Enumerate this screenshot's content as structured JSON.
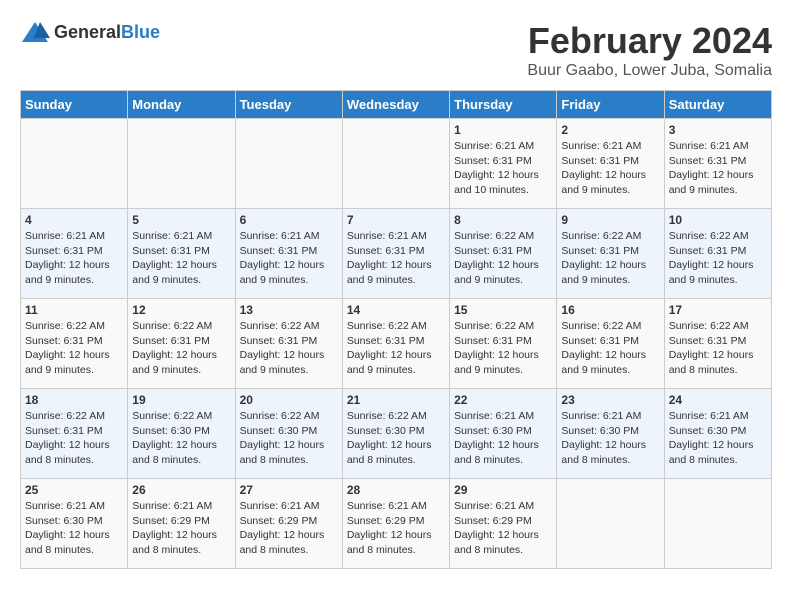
{
  "logo": {
    "general": "General",
    "blue": "Blue"
  },
  "title": "February 2024",
  "subtitle": "Buur Gaabo, Lower Juba, Somalia",
  "headers": [
    "Sunday",
    "Monday",
    "Tuesday",
    "Wednesday",
    "Thursday",
    "Friday",
    "Saturday"
  ],
  "weeks": [
    [
      {
        "day": "",
        "info": ""
      },
      {
        "day": "",
        "info": ""
      },
      {
        "day": "",
        "info": ""
      },
      {
        "day": "",
        "info": ""
      },
      {
        "day": "1",
        "info": "Sunrise: 6:21 AM\nSunset: 6:31 PM\nDaylight: 12 hours\nand 10 minutes."
      },
      {
        "day": "2",
        "info": "Sunrise: 6:21 AM\nSunset: 6:31 PM\nDaylight: 12 hours\nand 9 minutes."
      },
      {
        "day": "3",
        "info": "Sunrise: 6:21 AM\nSunset: 6:31 PM\nDaylight: 12 hours\nand 9 minutes."
      }
    ],
    [
      {
        "day": "4",
        "info": "Sunrise: 6:21 AM\nSunset: 6:31 PM\nDaylight: 12 hours\nand 9 minutes."
      },
      {
        "day": "5",
        "info": "Sunrise: 6:21 AM\nSunset: 6:31 PM\nDaylight: 12 hours\nand 9 minutes."
      },
      {
        "day": "6",
        "info": "Sunrise: 6:21 AM\nSunset: 6:31 PM\nDaylight: 12 hours\nand 9 minutes."
      },
      {
        "day": "7",
        "info": "Sunrise: 6:21 AM\nSunset: 6:31 PM\nDaylight: 12 hours\nand 9 minutes."
      },
      {
        "day": "8",
        "info": "Sunrise: 6:22 AM\nSunset: 6:31 PM\nDaylight: 12 hours\nand 9 minutes."
      },
      {
        "day": "9",
        "info": "Sunrise: 6:22 AM\nSunset: 6:31 PM\nDaylight: 12 hours\nand 9 minutes."
      },
      {
        "day": "10",
        "info": "Sunrise: 6:22 AM\nSunset: 6:31 PM\nDaylight: 12 hours\nand 9 minutes."
      }
    ],
    [
      {
        "day": "11",
        "info": "Sunrise: 6:22 AM\nSunset: 6:31 PM\nDaylight: 12 hours\nand 9 minutes."
      },
      {
        "day": "12",
        "info": "Sunrise: 6:22 AM\nSunset: 6:31 PM\nDaylight: 12 hours\nand 9 minutes."
      },
      {
        "day": "13",
        "info": "Sunrise: 6:22 AM\nSunset: 6:31 PM\nDaylight: 12 hours\nand 9 minutes."
      },
      {
        "day": "14",
        "info": "Sunrise: 6:22 AM\nSunset: 6:31 PM\nDaylight: 12 hours\nand 9 minutes."
      },
      {
        "day": "15",
        "info": "Sunrise: 6:22 AM\nSunset: 6:31 PM\nDaylight: 12 hours\nand 9 minutes."
      },
      {
        "day": "16",
        "info": "Sunrise: 6:22 AM\nSunset: 6:31 PM\nDaylight: 12 hours\nand 9 minutes."
      },
      {
        "day": "17",
        "info": "Sunrise: 6:22 AM\nSunset: 6:31 PM\nDaylight: 12 hours\nand 8 minutes."
      }
    ],
    [
      {
        "day": "18",
        "info": "Sunrise: 6:22 AM\nSunset: 6:31 PM\nDaylight: 12 hours\nand 8 minutes."
      },
      {
        "day": "19",
        "info": "Sunrise: 6:22 AM\nSunset: 6:30 PM\nDaylight: 12 hours\nand 8 minutes."
      },
      {
        "day": "20",
        "info": "Sunrise: 6:22 AM\nSunset: 6:30 PM\nDaylight: 12 hours\nand 8 minutes."
      },
      {
        "day": "21",
        "info": "Sunrise: 6:22 AM\nSunset: 6:30 PM\nDaylight: 12 hours\nand 8 minutes."
      },
      {
        "day": "22",
        "info": "Sunrise: 6:21 AM\nSunset: 6:30 PM\nDaylight: 12 hours\nand 8 minutes."
      },
      {
        "day": "23",
        "info": "Sunrise: 6:21 AM\nSunset: 6:30 PM\nDaylight: 12 hours\nand 8 minutes."
      },
      {
        "day": "24",
        "info": "Sunrise: 6:21 AM\nSunset: 6:30 PM\nDaylight: 12 hours\nand 8 minutes."
      }
    ],
    [
      {
        "day": "25",
        "info": "Sunrise: 6:21 AM\nSunset: 6:30 PM\nDaylight: 12 hours\nand 8 minutes."
      },
      {
        "day": "26",
        "info": "Sunrise: 6:21 AM\nSunset: 6:29 PM\nDaylight: 12 hours\nand 8 minutes."
      },
      {
        "day": "27",
        "info": "Sunrise: 6:21 AM\nSunset: 6:29 PM\nDaylight: 12 hours\nand 8 minutes."
      },
      {
        "day": "28",
        "info": "Sunrise: 6:21 AM\nSunset: 6:29 PM\nDaylight: 12 hours\nand 8 minutes."
      },
      {
        "day": "29",
        "info": "Sunrise: 6:21 AM\nSunset: 6:29 PM\nDaylight: 12 hours\nand 8 minutes."
      },
      {
        "day": "",
        "info": ""
      },
      {
        "day": "",
        "info": ""
      }
    ]
  ]
}
